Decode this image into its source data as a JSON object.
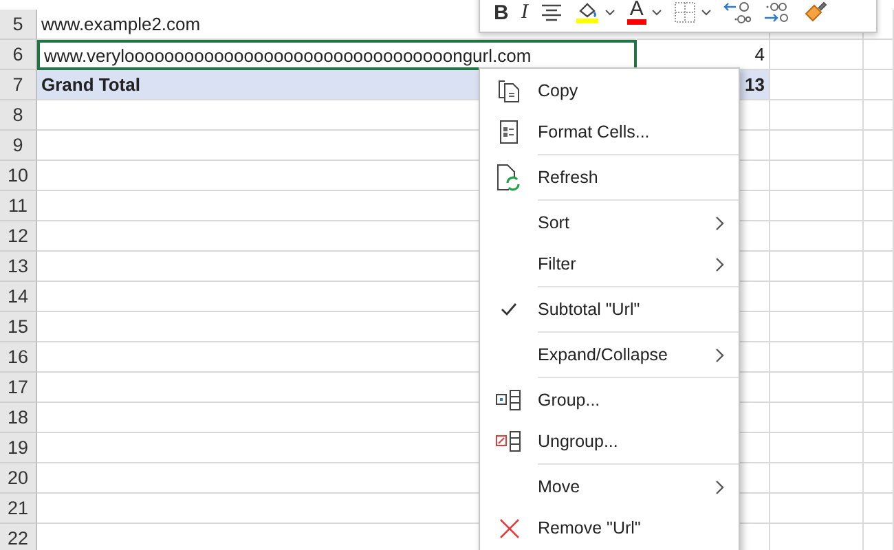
{
  "sheet": {
    "rows": [
      {
        "header": "5",
        "cell_a": "www.example2.com",
        "cell_b": "",
        "total": false,
        "selected": false
      },
      {
        "header": "6",
        "cell_a": "www.verylooooooooooooooooooooooooooooooooongurl.com",
        "cell_b": "4",
        "total": false,
        "selected": true
      },
      {
        "header": "7",
        "cell_a": "Grand Total",
        "cell_b": "13",
        "total": true,
        "selected": false
      },
      {
        "header": "8",
        "cell_a": "",
        "cell_b": "",
        "total": false,
        "selected": false
      },
      {
        "header": "9",
        "cell_a": "",
        "cell_b": "",
        "total": false,
        "selected": false
      },
      {
        "header": "10",
        "cell_a": "",
        "cell_b": "",
        "total": false,
        "selected": false
      },
      {
        "header": "11",
        "cell_a": "",
        "cell_b": "",
        "total": false,
        "selected": false
      },
      {
        "header": "12",
        "cell_a": "",
        "cell_b": "",
        "total": false,
        "selected": false
      },
      {
        "header": "13",
        "cell_a": "",
        "cell_b": "",
        "total": false,
        "selected": false
      },
      {
        "header": "14",
        "cell_a": "",
        "cell_b": "",
        "total": false,
        "selected": false
      },
      {
        "header": "15",
        "cell_a": "",
        "cell_b": "",
        "total": false,
        "selected": false
      },
      {
        "header": "16",
        "cell_a": "",
        "cell_b": "",
        "total": false,
        "selected": false
      },
      {
        "header": "17",
        "cell_a": "",
        "cell_b": "",
        "total": false,
        "selected": false
      },
      {
        "header": "18",
        "cell_a": "",
        "cell_b": "",
        "total": false,
        "selected": false
      },
      {
        "header": "19",
        "cell_a": "",
        "cell_b": "",
        "total": false,
        "selected": false
      },
      {
        "header": "20",
        "cell_a": "",
        "cell_b": "",
        "total": false,
        "selected": false
      },
      {
        "header": "21",
        "cell_a": "",
        "cell_b": "",
        "total": false,
        "selected": false
      },
      {
        "header": "22",
        "cell_a": "",
        "cell_b": "",
        "total": false,
        "selected": false
      }
    ]
  },
  "mini_toolbar": [
    {
      "kind": "bold",
      "label": "B"
    },
    {
      "kind": "italic",
      "label": "I"
    },
    {
      "kind": "align-center"
    },
    {
      "kind": "fill-color",
      "color": "#ffff00"
    },
    {
      "kind": "dropdown"
    },
    {
      "kind": "font-color",
      "label": "A",
      "color": "#ff0000"
    },
    {
      "kind": "dropdown"
    },
    {
      "kind": "borders"
    },
    {
      "kind": "dropdown"
    },
    {
      "kind": "increase-decimal"
    },
    {
      "kind": "decrease-decimal"
    },
    {
      "kind": "format-painter"
    }
  ],
  "context_menu": [
    {
      "label": "Copy",
      "kind": "copy",
      "checked": false,
      "submenu": false,
      "separator_before": false
    },
    {
      "label": "Format Cells...",
      "kind": "format-cells",
      "checked": false,
      "submenu": false,
      "separator_before": false
    },
    {
      "label": "Refresh",
      "kind": "refresh",
      "checked": false,
      "submenu": false,
      "separator_before": true
    },
    {
      "label": "Sort",
      "kind": "plain",
      "checked": false,
      "submenu": true,
      "separator_before": true
    },
    {
      "label": "Filter",
      "kind": "plain",
      "checked": false,
      "submenu": true,
      "separator_before": false
    },
    {
      "label": "Subtotal \"Url\"",
      "kind": "plain",
      "checked": true,
      "submenu": false,
      "separator_before": true
    },
    {
      "label": "Expand/Collapse",
      "kind": "plain",
      "checked": false,
      "submenu": true,
      "separator_before": true
    },
    {
      "label": "Group...",
      "kind": "group",
      "checked": false,
      "submenu": false,
      "separator_before": true
    },
    {
      "label": "Ungroup...",
      "kind": "ungroup",
      "checked": false,
      "submenu": false,
      "separator_before": false
    },
    {
      "label": "Move",
      "kind": "plain",
      "checked": false,
      "submenu": true,
      "separator_before": true
    },
    {
      "label": "Remove \"Url\"",
      "kind": "remove",
      "checked": false,
      "submenu": false,
      "separator_before": false
    }
  ]
}
